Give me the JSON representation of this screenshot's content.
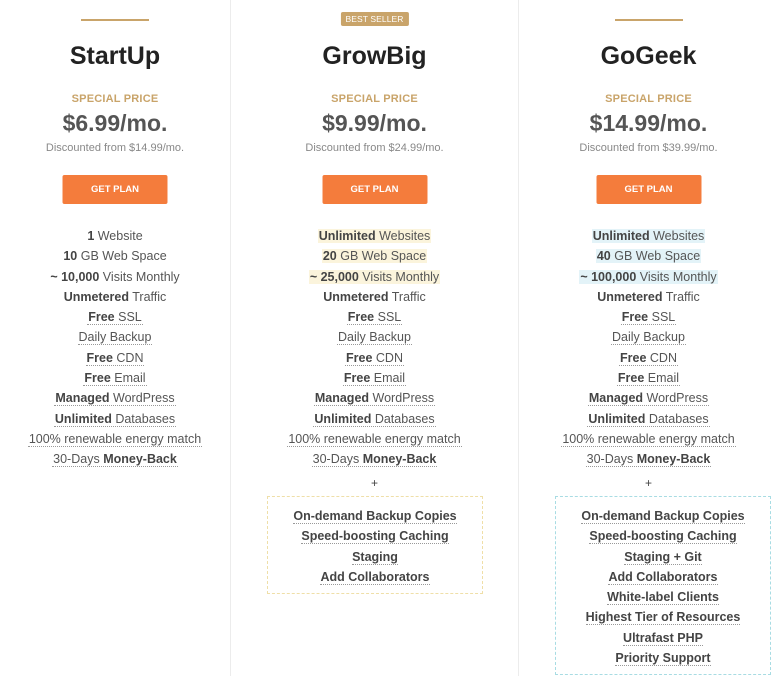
{
  "colors": {
    "accent_gold": "#c9a46a",
    "button_orange": "#f47c3c",
    "highlight_growbig": "#fbf4dc",
    "highlight_gogeek": "#e3f3f8"
  },
  "plans": [
    {
      "name": "StartUp",
      "badge": null,
      "special_label": "SPECIAL PRICE",
      "price": "$6.99/mo.",
      "discount": "Discounted from $14.99/mo.",
      "button": "GET PLAN",
      "features": [
        {
          "bold": "1",
          "text": " Website",
          "bold_first": true
        },
        {
          "bold": "10",
          "text": " GB Web Space",
          "bold_first": true
        },
        {
          "bold": "~ 10,000",
          "text": " Visits Monthly",
          "bold_first": true
        },
        {
          "bold": "Unmetered",
          "text": " Traffic",
          "bold_first": true
        },
        {
          "bold": "Free",
          "text": " SSL",
          "bold_first": true
        },
        {
          "bold": "",
          "text": "Daily Backup",
          "bold_first": true
        },
        {
          "bold": "Free",
          "text": " CDN",
          "bold_first": true
        },
        {
          "bold": "Free",
          "text": " Email",
          "bold_first": true
        },
        {
          "bold": "Managed",
          "text": " WordPress",
          "bold_first": true
        },
        {
          "bold": "Unlimited",
          "text": " Databases",
          "bold_first": true
        },
        {
          "bold": "",
          "text": "100% renewable energy match",
          "bold_first": true
        },
        {
          "bold": "Money-Back",
          "text": "30-Days ",
          "bold_first": false
        }
      ],
      "extras": []
    },
    {
      "name": "GrowBig",
      "badge": "BEST SELLER",
      "special_label": "SPECIAL PRICE",
      "price": "$9.99/mo.",
      "discount": "Discounted from $24.99/mo.",
      "button": "GET PLAN",
      "features": [
        {
          "bold": "Unlimited",
          "text": " Websites",
          "bold_first": true
        },
        {
          "bold": "20",
          "text": " GB Web Space",
          "bold_first": true
        },
        {
          "bold": "~ 25,000",
          "text": " Visits Monthly",
          "bold_first": true
        },
        {
          "bold": "Unmetered",
          "text": " Traffic",
          "bold_first": true
        },
        {
          "bold": "Free",
          "text": " SSL",
          "bold_first": true
        },
        {
          "bold": "",
          "text": "Daily Backup",
          "bold_first": true
        },
        {
          "bold": "Free",
          "text": " CDN",
          "bold_first": true
        },
        {
          "bold": "Free",
          "text": " Email",
          "bold_first": true
        },
        {
          "bold": "Managed",
          "text": " WordPress",
          "bold_first": true
        },
        {
          "bold": "Unlimited",
          "text": " Databases",
          "bold_first": true
        },
        {
          "bold": "",
          "text": "100% renewable energy match",
          "bold_first": true
        },
        {
          "bold": "Money-Back",
          "text": "30-Days ",
          "bold_first": false
        }
      ],
      "plus": "+",
      "extras": [
        "On-demand Backup Copies",
        "Speed-boosting Caching",
        "Staging",
        "Add Collaborators"
      ]
    },
    {
      "name": "GoGeek",
      "badge": null,
      "special_label": "SPECIAL PRICE",
      "price": "$14.99/mo.",
      "discount": "Discounted from $39.99/mo.",
      "button": "GET PLAN",
      "features": [
        {
          "bold": "Unlimited",
          "text": " Websites",
          "bold_first": true
        },
        {
          "bold": "40",
          "text": " GB Web Space",
          "bold_first": true
        },
        {
          "bold": "~ 100,000",
          "text": " Visits Monthly",
          "bold_first": true
        },
        {
          "bold": "Unmetered",
          "text": " Traffic",
          "bold_first": true
        },
        {
          "bold": "Free",
          "text": " SSL",
          "bold_first": true
        },
        {
          "bold": "",
          "text": "Daily Backup",
          "bold_first": true
        },
        {
          "bold": "Free",
          "text": " CDN",
          "bold_first": true
        },
        {
          "bold": "Free",
          "text": " Email",
          "bold_first": true
        },
        {
          "bold": "Managed",
          "text": " WordPress",
          "bold_first": true
        },
        {
          "bold": "Unlimited",
          "text": " Databases",
          "bold_first": true
        },
        {
          "bold": "",
          "text": "100% renewable energy match",
          "bold_first": true
        },
        {
          "bold": "Money-Back",
          "text": "30-Days ",
          "bold_first": false
        }
      ],
      "plus": "+",
      "extras": [
        "On-demand Backup Copies",
        "Speed-boosting Caching",
        "Staging + Git",
        "Add Collaborators",
        "White-label Clients",
        "Highest Tier of Resources",
        "Ultrafast PHP",
        "Priority Support"
      ]
    }
  ]
}
